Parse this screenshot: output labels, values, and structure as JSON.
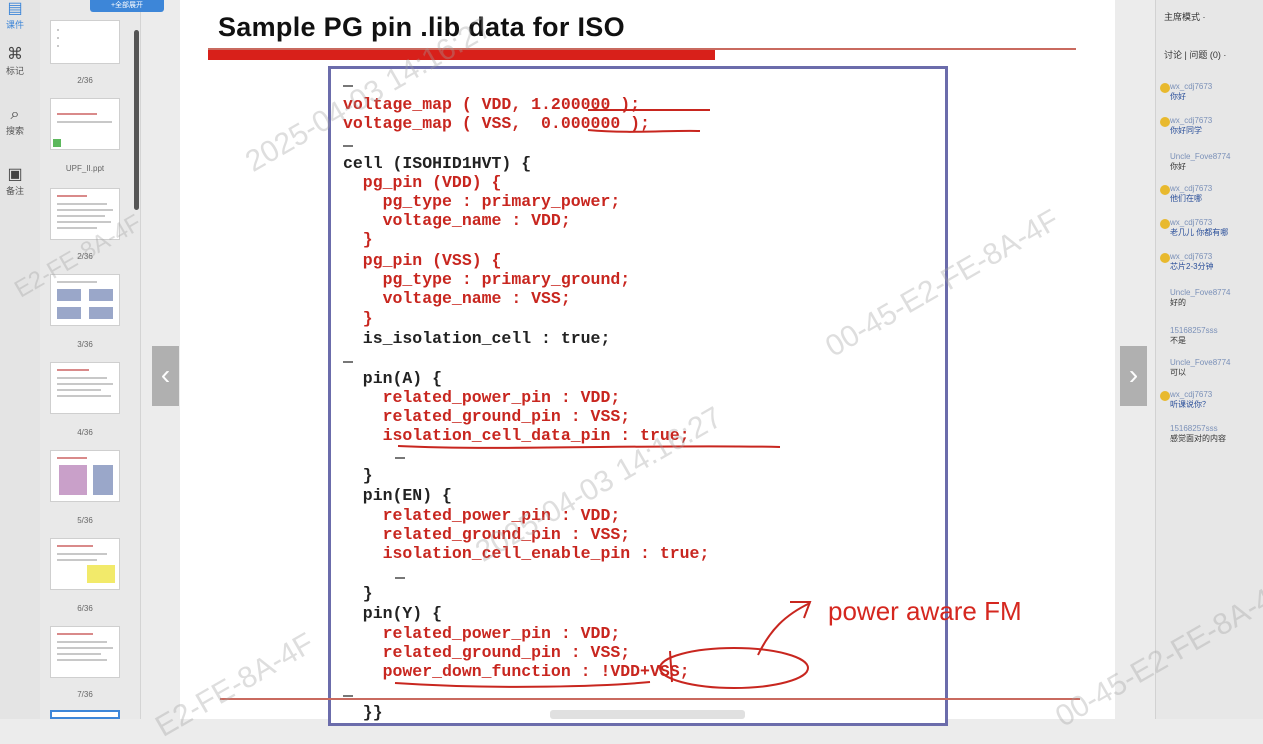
{
  "toolbar": {
    "items": [
      {
        "icon": "document-icon",
        "label": "课件"
      },
      {
        "icon": "tag-icon",
        "label": "标记"
      },
      {
        "icon": "search-icon",
        "label": "搜索"
      },
      {
        "icon": "notes-icon",
        "label": "备注"
      }
    ]
  },
  "thumbnails": {
    "top_tab": "+全部展开",
    "items": [
      {
        "label": "2/36"
      },
      {
        "label": "UPF_II.ppt"
      },
      {
        "label": "2/36"
      },
      {
        "label": "3/36"
      },
      {
        "label": "4/36"
      },
      {
        "label": "5/36"
      },
      {
        "label": "6/36"
      },
      {
        "label": "7/36"
      }
    ]
  },
  "slide": {
    "title": "Sample PG pin .lib data for ISO",
    "code": [
      "voltage_map ( VDD, 1.200000 );",
      "voltage_map ( VSS,  0.000000 );",
      "cell (ISOHID1HVT) {",
      "  pg_pin (VDD) {",
      "    pg_type : primary_power;",
      "    voltage_name : VDD;",
      "  }",
      "  pg_pin (VSS) {",
      "    pg_type : primary_ground;",
      "    voltage_name : VSS;",
      "  }",
      "  is_isolation_cell : true;",
      "  pin(A) {",
      "    related_power_pin : VDD;",
      "    related_ground_pin : VSS;",
      "    isolation_cell_data_pin : true;",
      "  }",
      "  pin(EN) {",
      "    related_power_pin : VDD;",
      "    related_ground_pin : VSS;",
      "    isolation_cell_enable_pin : true;",
      "  }",
      "  pin(Y) {",
      "    related_power_pin : VDD;",
      "    related_ground_pin : VSS;",
      "    power_down_function : !VDD+VSS;",
      "  }}"
    ],
    "annotation": "power aware FM"
  },
  "navigation": {
    "prev_label": "‹",
    "next_label": "›"
  },
  "chat": {
    "mode_label": "主席模式 ·",
    "tabs_label": "讨论 | 问题 (0) ·",
    "messages": [
      {
        "who": "wx_cdj7673",
        "text": "你好"
      },
      {
        "who": "wx_cdj7673",
        "text": "你好同学"
      },
      {
        "who": "Uncle_Fove8774",
        "text": "你好"
      },
      {
        "who": "wx_cdj7673",
        "text": "他们在哪"
      },
      {
        "who": "wx_cdj7673",
        "text": "老几儿 你都有哪"
      },
      {
        "who": "wx_cdj7673",
        "text": "芯片2-3分钟"
      },
      {
        "who": "Uncle_Fove8774",
        "text": "好的"
      },
      {
        "who": "15168257sss",
        "text": "不是"
      },
      {
        "who": "Uncle_Fove8774",
        "text": "可以"
      },
      {
        "who": "wx_cdj7673",
        "text": "听课说你？"
      },
      {
        "who": "15168257sss",
        "text": "感觉面对的内容"
      }
    ]
  },
  "watermark": {
    "date_text": "2025-04-03 14:16:27",
    "mac_text": "00-45-E2-FE-8A-4F",
    "short_text": "E2-FE-8A-4F"
  },
  "colors": {
    "accent_red": "#d8201a",
    "code_red": "#c8261f",
    "box_border": "#6b6cab"
  }
}
